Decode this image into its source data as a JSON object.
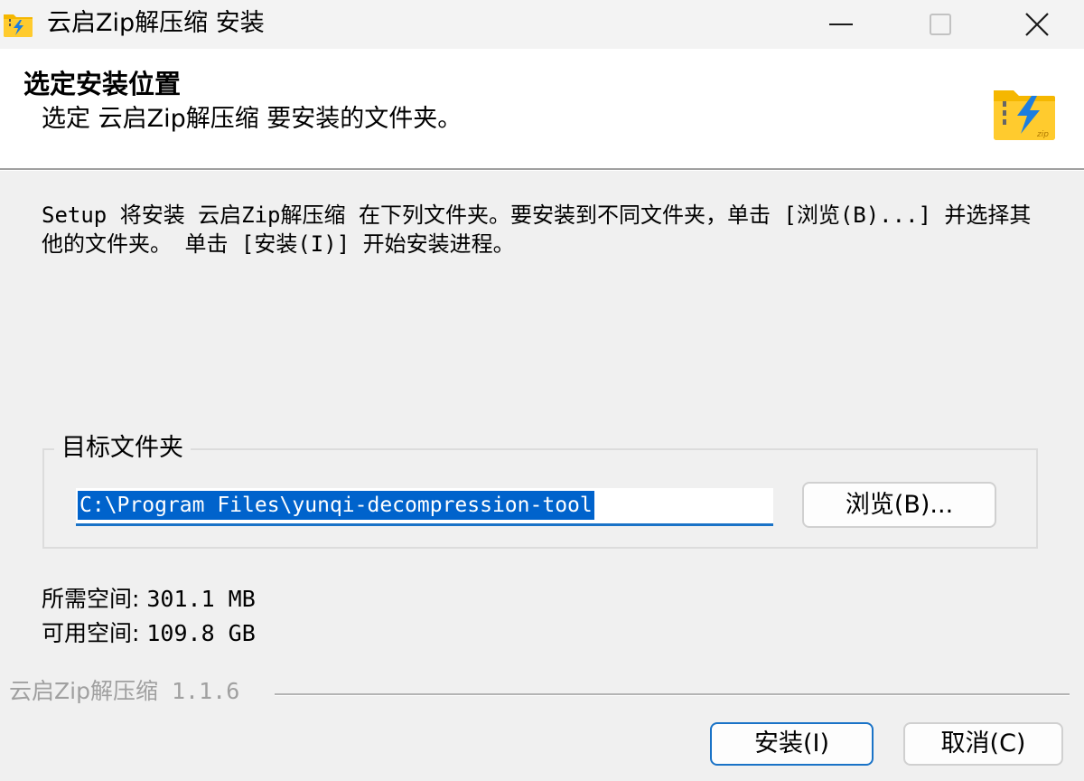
{
  "window": {
    "title": "云启Zip解压缩 安装"
  },
  "header": {
    "title": "选定安装位置",
    "subtitle": "选定 云启Zip解压缩 要安装的文件夹。",
    "logo_icon": "zip-folder-lightning-icon"
  },
  "body": {
    "instruction": "Setup 将安装 云启Zip解压缩 在下列文件夹。要安装到不同文件夹，单击 [浏览(B)...] 并选择其他的文件夹。 单击 [安装(I)] 开始安装进程。",
    "group_label": "目标文件夹",
    "path_value": "C:\\Program Files\\yunqi-decompression-tool",
    "browse_label": "浏览(B)...",
    "space_required_label": "所需空间: ",
    "space_required_value": "301.1 MB",
    "space_available_label": "可用空间: ",
    "space_available_value": "109.8 GB"
  },
  "footer": {
    "brand": "云启Zip解压缩",
    "version": " 1.1.6",
    "install_label": "安装(I)",
    "cancel_label": "取消(C)"
  },
  "colors": {
    "accent": "#1a73c7",
    "selection": "#0063cc",
    "folder_yellow": "#f5b700"
  }
}
